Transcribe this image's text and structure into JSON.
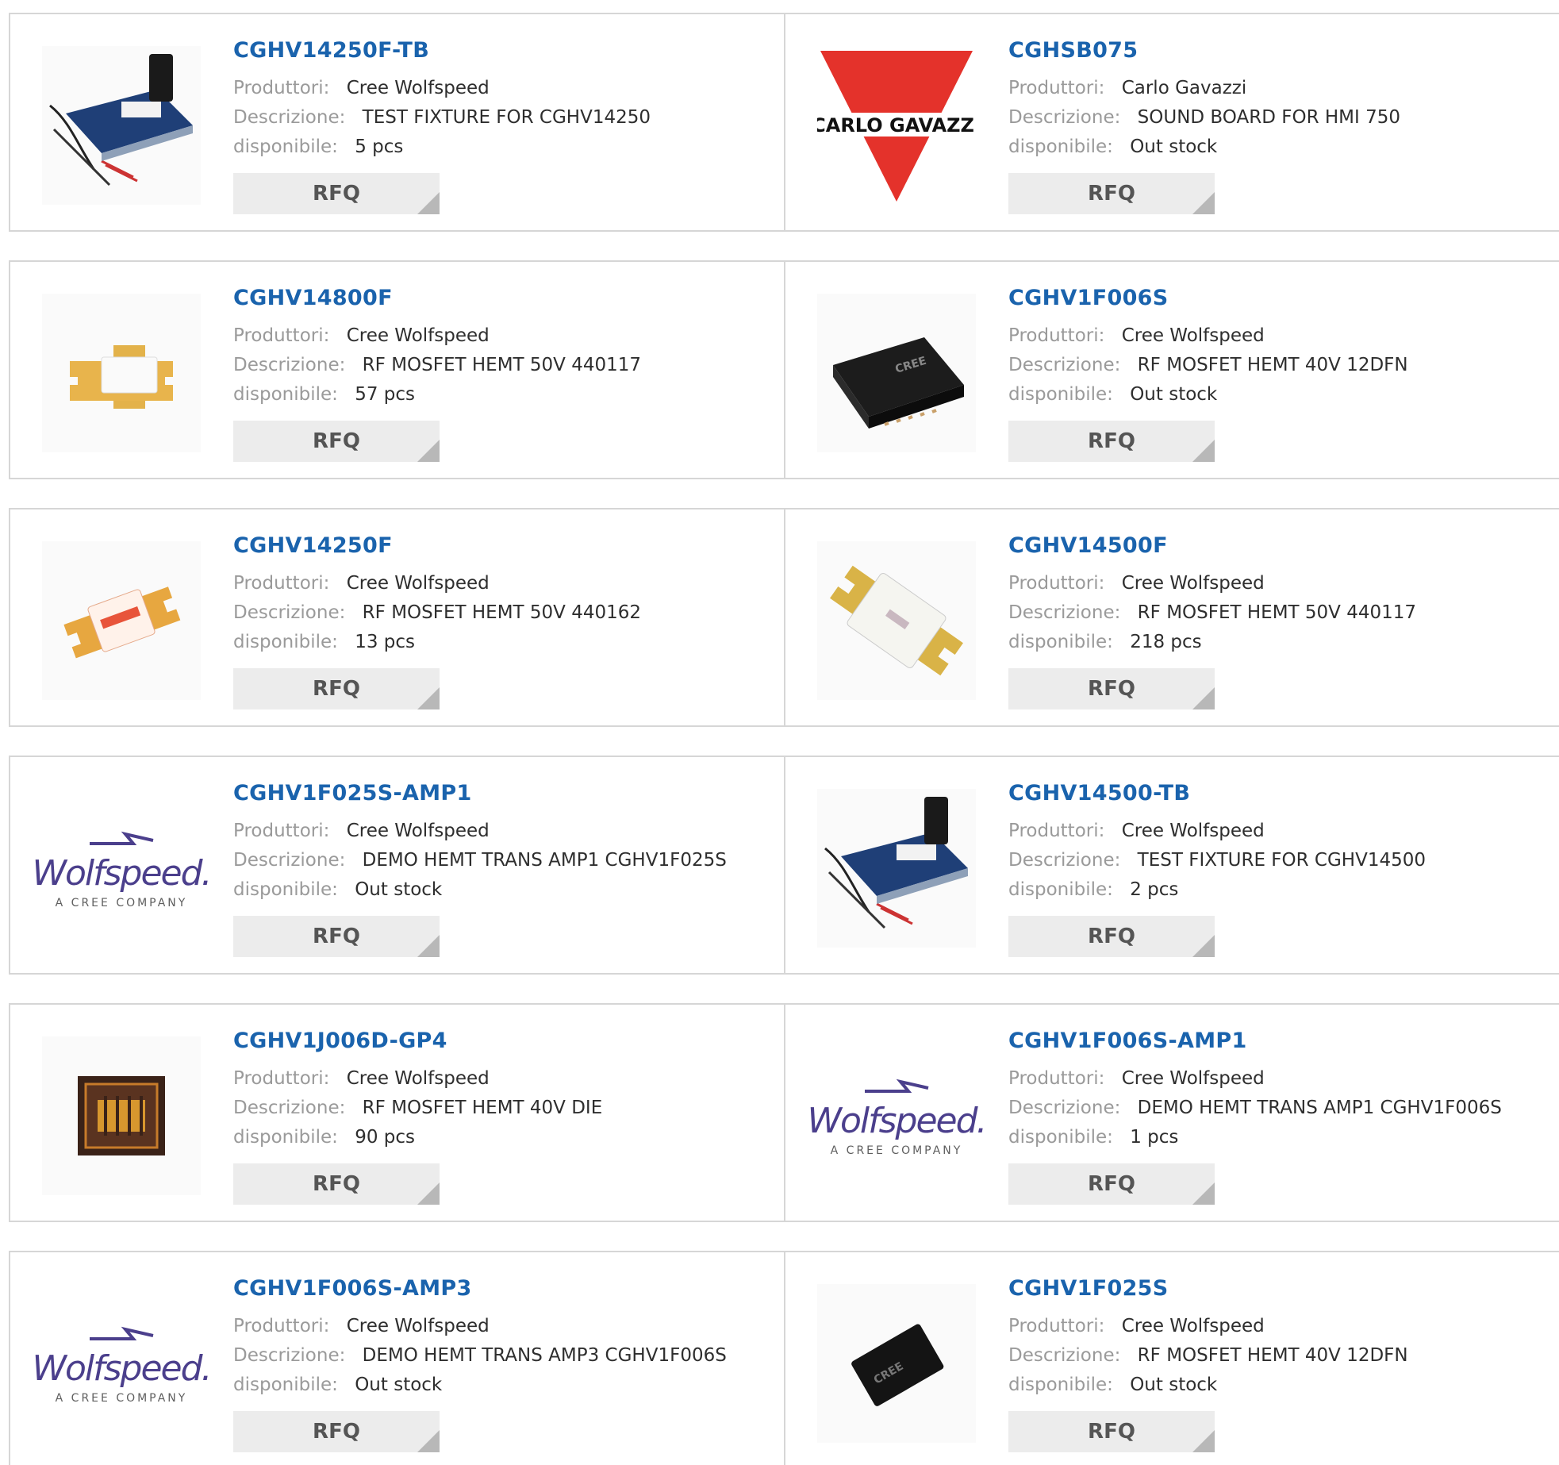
{
  "labels": {
    "manufacturer": "Produttori:",
    "description": "Descrizione:",
    "availability": "disponibile:",
    "rfq": "RFQ"
  },
  "logo_text": {
    "carlo_gavazzi": "CARLO GAVAZZI",
    "wolfspeed": "Wolfspeed.",
    "wolfspeed_sub": "A CREE COMPANY"
  },
  "products": [
    {
      "part": "CGHV14250F-TB",
      "manufacturer": "Cree Wolfspeed",
      "description": "TEST FIXTURE FOR CGHV14250",
      "availability": "5 pcs",
      "image": "test-fixture-board"
    },
    {
      "part": "CGHSB075",
      "manufacturer": "Carlo Gavazzi",
      "description": "SOUND BOARD FOR HMI 750",
      "availability": "Out stock",
      "image": "carlo-gavazzi-logo"
    },
    {
      "part": "CGHV14800F",
      "manufacturer": "Cree Wolfspeed",
      "description": "RF MOSFET HEMT 50V 440117",
      "availability": "57 pcs",
      "image": "flange-package"
    },
    {
      "part": "CGHV1F006S",
      "manufacturer": "Cree Wolfspeed",
      "description": "RF MOSFET HEMT 40V 12DFN",
      "availability": "Out stock",
      "image": "dfn-chip"
    },
    {
      "part": "CGHV14250F",
      "manufacturer": "Cree Wolfspeed",
      "description": "RF MOSFET HEMT 50V 440162",
      "availability": "13 pcs",
      "image": "flange-package-small"
    },
    {
      "part": "CGHV14500F",
      "manufacturer": "Cree Wolfspeed",
      "description": "RF MOSFET HEMT 50V 440117",
      "availability": "218 pcs",
      "image": "flange-package-large"
    },
    {
      "part": "CGHV1F025S-AMP1",
      "manufacturer": "Cree Wolfspeed",
      "description": "DEMO HEMT TRANS AMP1 CGHV1F025S",
      "availability": "Out stock",
      "image": "wolfspeed-logo"
    },
    {
      "part": "CGHV14500-TB",
      "manufacturer": "Cree Wolfspeed",
      "description": "TEST FIXTURE FOR CGHV14500",
      "availability": "2 pcs",
      "image": "test-fixture-board"
    },
    {
      "part": "CGHV1J006D-GP4",
      "manufacturer": "Cree Wolfspeed",
      "description": "RF MOSFET HEMT 40V DIE",
      "availability": "90 pcs",
      "image": "bare-die"
    },
    {
      "part": "CGHV1F006S-AMP1",
      "manufacturer": "Cree Wolfspeed",
      "description": "DEMO HEMT TRANS AMP1 CGHV1F006S",
      "availability": "1 pcs",
      "image": "wolfspeed-logo"
    },
    {
      "part": "CGHV1F006S-AMP3",
      "manufacturer": "Cree Wolfspeed",
      "description": "DEMO HEMT TRANS AMP3 CGHV1F006S",
      "availability": "Out stock",
      "image": "wolfspeed-logo"
    },
    {
      "part": "CGHV1F025S",
      "manufacturer": "Cree Wolfspeed",
      "description": "RF MOSFET HEMT 40V 12DFN",
      "availability": "Out stock",
      "image": "dfn-chip-tilted"
    }
  ],
  "colors": {
    "part_link": "#1a63ad",
    "label": "#9a9a9a",
    "value": "#2e2e2e",
    "button_bg": "#ececec",
    "border": "#d6d6d6"
  }
}
